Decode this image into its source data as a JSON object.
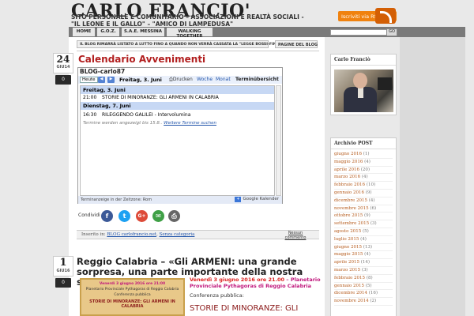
{
  "site": {
    "title": "CARLO FRANCIO'",
    "description": "SITO PERSONALE E COMUNITARIO – ASSOCIAZIONI E REALTÀ SOCIALI - \"IL LEONE E IL GALLO\" – \"AMICO DI LAMPEDUSA\"",
    "rss_label": "Iscriviti via RSS"
  },
  "nav": {
    "items": [
      "HOME",
      "G.O.Z.",
      "S.A.E. MESSINA",
      "WALKING TOGETHER"
    ],
    "search_button": "GO"
  },
  "subnav": {
    "items": [
      "IL BLOG RIMARRÀ LISTATO A LUTTO FINO A QUANDO NON VERRÀ CASSATA LA \"LEGGE BOSSI-FINI\"",
      "PAGINE DEL BLOG"
    ]
  },
  "post1": {
    "day": "24",
    "month": "GIU14",
    "comments": "0",
    "title": "Calendario Avvenimenti",
    "calendar": {
      "title": "BLOG-carlo87",
      "today": "Heute",
      "prev": "◀",
      "next": "▶",
      "current_date": "Freitag, 3. Juni",
      "print": "Drucken",
      "views": [
        "Woche",
        "Monat",
        "Terminübersicht"
      ],
      "days": [
        {
          "label": "Freitag, 3. Juni",
          "events": [
            {
              "time": "21:00",
              "title": "STORIE DI MINORANZE: GLI ARMENI IN CALABRIA"
            }
          ]
        },
        {
          "label": "Dienstag, 7. Juni",
          "events": [
            {
              "time": "16:30",
              "title": "RILEGGENDO GALILEI - Intervolumina"
            }
          ]
        }
      ],
      "note": "Termine werden angezeigt bis 15.8..",
      "note_link": "Weitere Termine suchen",
      "timezone": "Terminanzeige in der Zeitzone: Rom",
      "gcal": "Google Kalender"
    },
    "share_label": "Condividi",
    "share_icons": [
      "facebook-icon",
      "twitter-icon",
      "google-plus-icon",
      "email-icon",
      "print-icon"
    ],
    "meta_prefix": "Inserito in:",
    "meta_links": [
      "BLOG carlofrancio.net",
      "Senza categoria"
    ],
    "comment_link": "Nessun commento"
  },
  "post2": {
    "day": "1",
    "month": "GIU16",
    "comments": "0",
    "title": "Reggio Calabria – «Gli ARMENI: una grande sorpresa, una parte importante della nostra storia»",
    "image_lines": [
      "Venerdì 3 giugno 2016 ore 21:00",
      "Planetario Provinciale Pythagoras di Reggio Calabria",
      "Conferenza pubblica",
      "STORIE DI MINORANZE: GLI ARMENI IN CALABRIA"
    ],
    "date_text": "Venerdì 3 giugno 2016 ore 21.00",
    "place_text": "Planetario Provinciale Pythagoras di Reggio Calabria",
    "sub": "Conferenza pubblica:",
    "headline": "STORIE DI MINORANZE: GLI"
  },
  "sidebar": {
    "author_title": "Carlo Franciò",
    "archive_title": "Archivio POST",
    "archive": [
      {
        "label": "giugno 2016",
        "count": "(1)"
      },
      {
        "label": "maggio 2016",
        "count": "(4)"
      },
      {
        "label": "aprile 2016",
        "count": "(20)"
      },
      {
        "label": "marzo 2016",
        "count": "(4)"
      },
      {
        "label": "febbraio 2016",
        "count": "(10)"
      },
      {
        "label": "gennaio 2016",
        "count": "(9)"
      },
      {
        "label": "dicembre 2015",
        "count": "(4)"
      },
      {
        "label": "novembre 2015",
        "count": "(6)"
      },
      {
        "label": "ottobre 2015",
        "count": "(9)"
      },
      {
        "label": "settembre 2015",
        "count": "(3)"
      },
      {
        "label": "agosto 2015",
        "count": "(5)"
      },
      {
        "label": "luglio 2015",
        "count": "(4)"
      },
      {
        "label": "giugno 2015",
        "count": "(13)"
      },
      {
        "label": "maggio 2015",
        "count": "(4)"
      },
      {
        "label": "aprile 2015",
        "count": "(14)"
      },
      {
        "label": "marzo 2015",
        "count": "(3)"
      },
      {
        "label": "febbraio 2015",
        "count": "(8)"
      },
      {
        "label": "gennaio 2015",
        "count": "(5)"
      },
      {
        "label": "dicembre 2014",
        "count": "(16)"
      },
      {
        "label": "novembre 2014",
        "count": "(2)"
      }
    ]
  }
}
